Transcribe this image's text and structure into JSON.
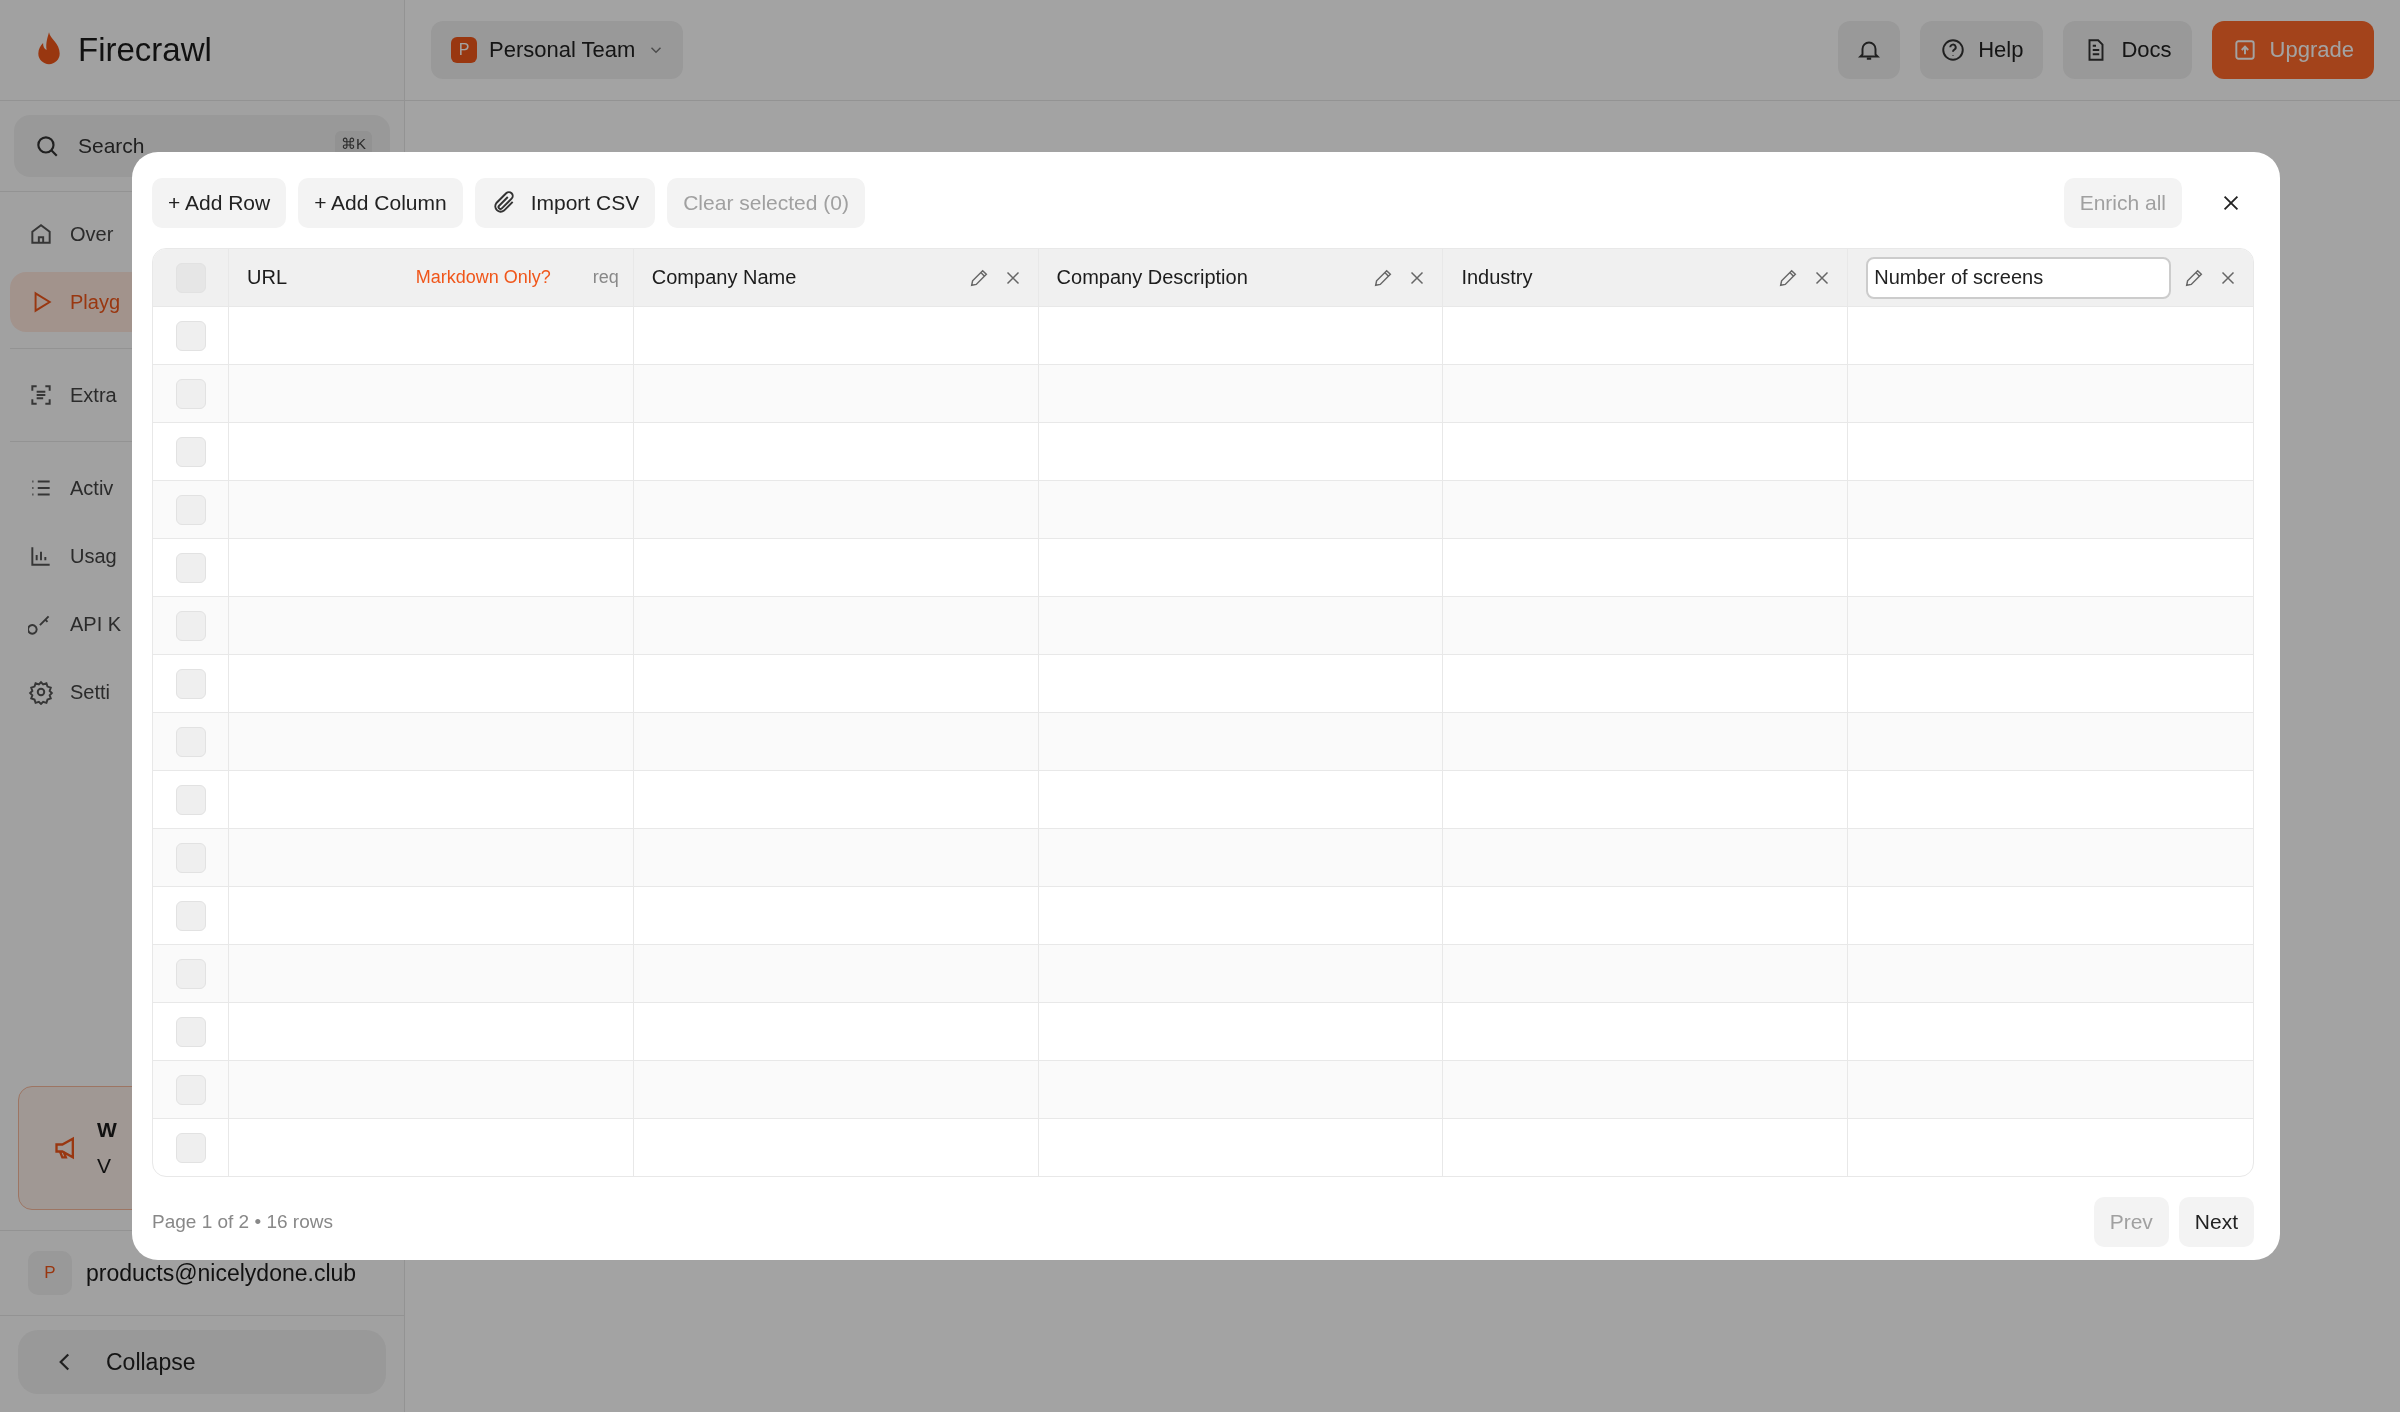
{
  "brand": {
    "name": "Firecrawl"
  },
  "search": {
    "placeholder": "Search",
    "shortcut": "⌘K"
  },
  "sidebar": {
    "items": [
      {
        "label": "Over",
        "selected": false
      },
      {
        "label": "Playg",
        "selected": true
      },
      {
        "label": "Extra",
        "selected": false
      },
      {
        "label": "Activ",
        "selected": false
      },
      {
        "label": "Usag",
        "selected": false
      },
      {
        "label": "API K",
        "selected": false
      },
      {
        "label": "Setti",
        "selected": false
      }
    ]
  },
  "promo": {
    "title": "W",
    "text": "V"
  },
  "account": {
    "initial": "P",
    "email": "products@nicelydone.club"
  },
  "collapse": {
    "label": "Collapse"
  },
  "header": {
    "team": {
      "initial": "P",
      "name": "Personal Team"
    },
    "help": "Help",
    "docs": "Docs",
    "upgrade": "Upgrade"
  },
  "modal": {
    "toolbar": [
      {
        "kind": "add",
        "label": "+ Add Row",
        "disabled": false
      },
      {
        "kind": "add",
        "label": "+ Add Column",
        "disabled": false
      },
      {
        "kind": "import",
        "label": "Import CSV",
        "disabled": false
      },
      {
        "kind": "clear",
        "label": "Clear selected (0)",
        "disabled": true
      }
    ],
    "enrich_all": {
      "label": "Enrich all",
      "disabled": true
    },
    "table": {
      "all_checked": false,
      "columns": [
        {
          "kind": "url",
          "label": "URL",
          "option": "Markdown Only?",
          "tag": "req"
        },
        {
          "kind": "field",
          "label": "Company Name",
          "editing": false
        },
        {
          "kind": "field",
          "label": "Company Description",
          "editing": false
        },
        {
          "kind": "field",
          "label": "Industry",
          "editing": false
        },
        {
          "kind": "field",
          "label": "Number of screens",
          "editing": true
        }
      ],
      "rows": [
        {
          "checked": false
        },
        {
          "checked": false
        },
        {
          "checked": false
        },
        {
          "checked": false
        },
        {
          "checked": false
        },
        {
          "checked": false
        },
        {
          "checked": false
        },
        {
          "checked": false
        },
        {
          "checked": false
        },
        {
          "checked": false
        },
        {
          "checked": false
        },
        {
          "checked": false
        },
        {
          "checked": false
        },
        {
          "checked": false
        },
        {
          "checked": false
        }
      ]
    },
    "footer": {
      "status": "Page 1 of 2 • 16 rows",
      "prev": {
        "label": "Prev",
        "disabled": true
      },
      "next": {
        "label": "Next",
        "disabled": false
      }
    }
  }
}
